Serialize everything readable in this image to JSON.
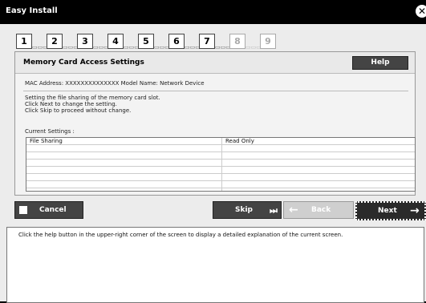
{
  "window": {
    "title": "Easy Install",
    "close_icon": "close-icon"
  },
  "steps": [
    {
      "number": "1",
      "active": true
    },
    {
      "number": "2",
      "active": true
    },
    {
      "number": "3",
      "active": true
    },
    {
      "number": "4",
      "active": true
    },
    {
      "number": "5",
      "active": true
    },
    {
      "number": "6",
      "active": true
    },
    {
      "number": "7",
      "active": true
    },
    {
      "number": "8",
      "active": false
    },
    {
      "number": "9",
      "active": false
    }
  ],
  "panel": {
    "title": "Memory Card Access Settings",
    "help_label": "Help",
    "mac_line": "MAC Address: XXXXXXXXXXXXXX   Model Name: Network Device",
    "desc_line1": "Setting the file sharing of the memory card slot.",
    "desc_line2": "Click Next to change the setting.",
    "desc_line3": "Click Skip to proceed without change.",
    "current_settings_label": "Current Settings :",
    "table": [
      {
        "name": "File Sharing",
        "value": "Read Only"
      }
    ]
  },
  "buttons": {
    "cancel": "Cancel",
    "skip": "Skip",
    "back": "Back",
    "next": "Next"
  },
  "help_text": "Click the help button in the upper-right corner of the screen to display a detailed explanation of the current screen."
}
